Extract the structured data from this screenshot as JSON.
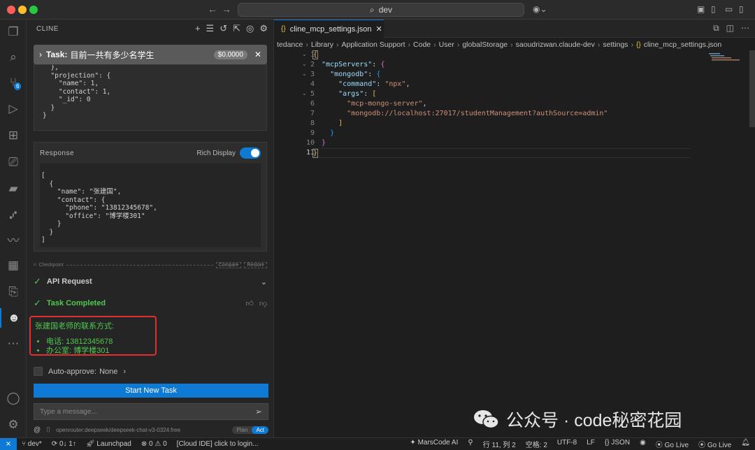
{
  "titlebar": {
    "search_text": "dev"
  },
  "activity": {
    "scm_badge": "6"
  },
  "sidebar": {
    "header": "CLINE",
    "task_label": "Task:",
    "task_title": "目前一共有多少名学生",
    "task_cost": "$0.0000",
    "query_code": "  },\n  \"projection\": {\n    \"name\": 1,\n    \"contact\": 1,\n    \"_id\": 0\n  }\n}",
    "response_label": "Response",
    "rich_display_label": "Rich Display",
    "response_code": "[\n  {\n    \"name\": \"张建国\",\n    \"contact\": {\n      \"phone\": \"13812345678\",\n      \"office\": \"博学楼301\"\n    }\n  }\n]",
    "checkpoint_label": "Checkpoint",
    "compare_label": "Compare",
    "restore_label": "Restore",
    "api_request_label": "API Request",
    "task_completed_label": "Task Completed",
    "result_title": "张建国老师的联系方式:",
    "result_items": [
      "电话: 13812345678",
      "办公室: 博学楼301"
    ],
    "auto_approve_label": "Auto-approve:",
    "auto_approve_value": "None",
    "start_button": "Start New Task",
    "message_placeholder": "Type a message...",
    "model_name": "openrouter:deepseek/deepseek-chat-v3-0324:free",
    "plan_label": "Plan",
    "act_label": "Act"
  },
  "editor": {
    "tab_title": "cline_mcp_settings.json",
    "breadcrumbs": [
      "tedance",
      "Library",
      "Application Support",
      "Code",
      "User",
      "globalStorage",
      "saoudrizwan.claude-dev",
      "settings",
      "cline_mcp_settings.json"
    ],
    "line_numbers": [
      "1",
      "2",
      "3",
      "4",
      "5",
      "6",
      "7",
      "8",
      "9",
      "10",
      "11"
    ],
    "code": {
      "l2_key": "\"mcpServers\"",
      "l3_key": "\"mongodb\"",
      "l4_key": "\"command\"",
      "l4_val": "\"npx\"",
      "l5_key": "\"args\"",
      "l6_val": "\"mcp-mongo-server\"",
      "l7_val": "\"mongodb://localhost:27017/studentManagement?authSource=admin\""
    }
  },
  "watermark": {
    "text": "公众号 · code秘密花园"
  },
  "statusbar": {
    "branch": "dev*",
    "sync": "0↓ 1↑",
    "launchpad": "Launchpad",
    "problems": "⊗ 0 ⚠ 0",
    "cloud_ide": "[Cloud IDE] click to login...",
    "marscode": "MarsCode AI",
    "position": "行 11, 列 2",
    "spaces": "空格: 2",
    "encoding": "UTF-8",
    "eol": "LF",
    "language": "{} JSON",
    "go_live_1": "Go Live",
    "go_live_2": "Go Live"
  }
}
